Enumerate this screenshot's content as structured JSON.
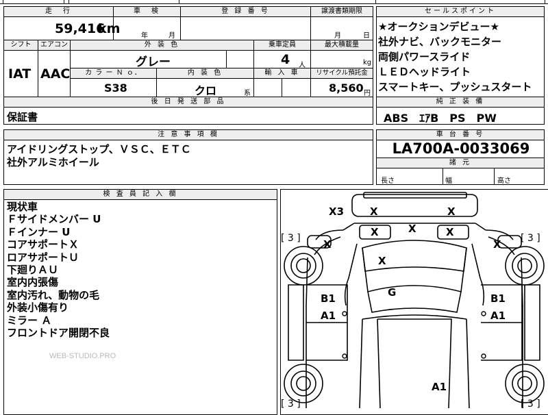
{
  "top_strip": {
    "partial_text": "…"
  },
  "header_row1": {
    "mileage_label": "走　行",
    "inspection_label": "車　検",
    "registration_label": "登 録 番 号",
    "transfer_label": "譲渡書類期限",
    "mileage_value": "59,416",
    "mileage_unit": "km",
    "inspection_year": "年",
    "inspection_month": "月",
    "transfer_month": "月",
    "transfer_day": "日"
  },
  "header_row2": {
    "shift_label": "シフト",
    "ac_label": "エアコン",
    "color_label": "外 装 色",
    "capacity_label": "乗車定員",
    "max_load_label": "最大積載量",
    "shift_value": "IAT",
    "ac_value": "AAC",
    "color_value": "グレー",
    "capacity_value": "4",
    "capacity_unit": "人",
    "max_load_unit": "kg",
    "color_no_label": "カ ラ ー Ｎ ｏ．",
    "interior_label": "内 装 色",
    "import_label": "輸 入 車",
    "recycle_label": "リサイクル預託金",
    "color_no_value": "S38",
    "interior_value": "クロ",
    "interior_suffix": "系",
    "recycle_value": "8,560",
    "recycle_unit": "円"
  },
  "later_parts": {
    "label": "後 日 発 送 部 品",
    "value": "保証書"
  },
  "notes": {
    "label": "注 意 事 項 欄",
    "lines": [
      "アイドリングストップ、ＶＳＣ、ＥＴＣ",
      "社外アルミホイール"
    ]
  },
  "sales_points": {
    "label": "セールスポイント",
    "lines": [
      "★オークションデビュー★",
      "社外ナビ、バックモニター",
      "両側パワースライド",
      "ＬＥＤヘッドライト",
      "スマートキー、プッシュスタート"
    ]
  },
  "equipment": {
    "label": "純 正 装 備",
    "value": "ABS　ｴｱB　PS　PW"
  },
  "chassis": {
    "label": "車 台 番 号",
    "value": "LA700A-0033069"
  },
  "dimensions": {
    "label": "諸 元",
    "length": "長さ",
    "width": "幅",
    "height": "高さ"
  },
  "inspector": {
    "label": "検 査 員 記 入 欄",
    "lines": [
      "現状車",
      "Ｆサイドメンバー U",
      "Ｆインナー U",
      "コアサポートＸ",
      "ロアサポートＵ",
      "下廻りＡＵ",
      "室内内張傷",
      "室内汚れ、動物の毛",
      "外装小傷有り",
      "ミラー Ａ",
      "フロントドア開閉不良"
    ],
    "watermark": "WEB-STUDIO.PRO"
  },
  "diagram": {
    "tire_marks": [
      "[ 3 ]",
      "[ 3 ]",
      "[ 3 ]",
      "[ 3 ]"
    ],
    "marks": [
      "X3",
      "X",
      "X",
      "X",
      "X",
      "X",
      "X",
      "X",
      "X",
      "G",
      "B1",
      "A1",
      "B1",
      "A1",
      "A1"
    ]
  }
}
